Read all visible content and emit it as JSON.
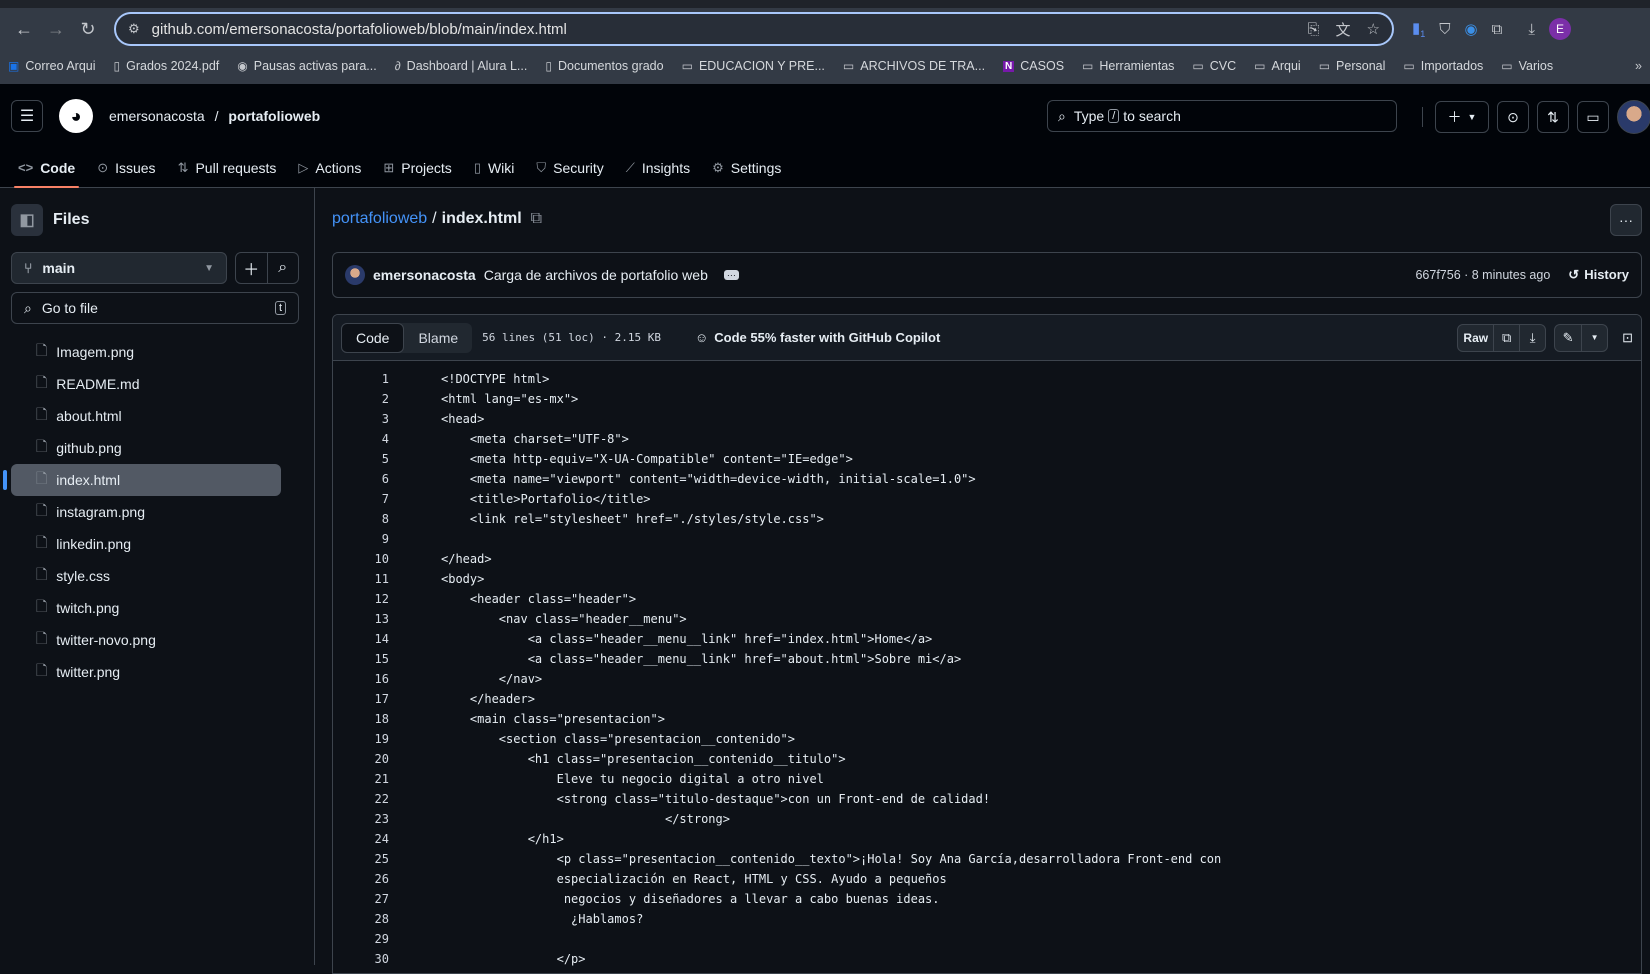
{
  "browser": {
    "url": "github.com/emersonacosta/portafolioweb/blob/main/index.html",
    "extension_badge": "1",
    "profile_initial": "E",
    "bookmarks": [
      {
        "label": "Correo Arqui",
        "icon": "outlook-icon"
      },
      {
        "label": "Grados 2024.pdf",
        "icon": "drive-file-icon"
      },
      {
        "label": "Pausas activas para...",
        "icon": "site-icon"
      },
      {
        "label": "Dashboard | Alura L...",
        "icon": "alura-icon"
      },
      {
        "label": "Documentos grado",
        "icon": "drive-file-icon"
      },
      {
        "label": "EDUCACION Y PRE...",
        "icon": "folder-icon"
      },
      {
        "label": "ARCHIVOS DE TRA...",
        "icon": "folder-icon"
      },
      {
        "label": "CASOS",
        "icon": "onenote-icon"
      },
      {
        "label": "Herramientas",
        "icon": "folder-icon"
      },
      {
        "label": "CVC",
        "icon": "folder-icon"
      },
      {
        "label": "Arqui",
        "icon": "folder-icon"
      },
      {
        "label": "Personal",
        "icon": "folder-icon"
      },
      {
        "label": "Importados",
        "icon": "folder-icon"
      },
      {
        "label": "Varios",
        "icon": "folder-icon"
      }
    ]
  },
  "header": {
    "owner": "emersonacosta",
    "separator": "/",
    "repo": "portafolioweb",
    "search_prefix": "Type",
    "search_key": "/",
    "search_suffix": "to search"
  },
  "repo_nav": [
    {
      "label": "Code",
      "icon": "code-icon",
      "active": true
    },
    {
      "label": "Issues",
      "icon": "issue-icon"
    },
    {
      "label": "Pull requests",
      "icon": "pull-request-icon"
    },
    {
      "label": "Actions",
      "icon": "play-icon"
    },
    {
      "label": "Projects",
      "icon": "table-icon"
    },
    {
      "label": "Wiki",
      "icon": "book-icon"
    },
    {
      "label": "Security",
      "icon": "shield-icon"
    },
    {
      "label": "Insights",
      "icon": "graph-icon"
    },
    {
      "label": "Settings",
      "icon": "gear-icon"
    }
  ],
  "sidebar": {
    "title": "Files",
    "branch": "main",
    "go_to_file": "Go to file",
    "go_to_file_key": "t",
    "files": [
      "Imagem.png",
      "README.md",
      "about.html",
      "github.png",
      "index.html",
      "instagram.png",
      "linkedin.png",
      "style.css",
      "twitch.png",
      "twitter-novo.png",
      "twitter.png"
    ],
    "selected": "index.html"
  },
  "breadcrumb": {
    "repo": "portafolioweb",
    "sep": "/",
    "file": "index.html"
  },
  "commit": {
    "author": "emersonacosta",
    "message": "Carga de archivos de portafolio web",
    "meta": "667f756 · 8 minutes ago",
    "history": "History"
  },
  "toolbar": {
    "code": "Code",
    "blame": "Blame",
    "info": "56 lines (51 loc) · 2.15 KB",
    "copilot": "Code 55% faster with GitHub Copilot",
    "raw": "Raw"
  },
  "colors": {
    "accent": "#4493f8",
    "tab_underline": "#f78166",
    "tag": "#7ee787",
    "attr": "#79c0ff",
    "string": "#a5d6ff"
  },
  "code_lines": [
    "<!DOCTYPE html>",
    "<html lang=\"es-mx\">",
    "<head>",
    "    <meta charset=\"UTF-8\">",
    "    <meta http-equiv=\"X-UA-Compatible\" content=\"IE=edge\">",
    "    <meta name=\"viewport\" content=\"width=device-width, initial-scale=1.0\">",
    "    <title>Portafolio</title>",
    "    <link rel=\"stylesheet\" href=\"./styles/style.css\">",
    "",
    "</head>",
    "<body>",
    "    <header class=\"header\">",
    "        <nav class=\"header__menu\">",
    "            <a class=\"header__menu__link\" href=\"index.html\">Home</a>",
    "            <a class=\"header__menu__link\" href=\"about.html\">Sobre mi</a>",
    "        </nav>",
    "    </header>",
    "    <main class=\"presentacion\">",
    "        <section class=\"presentacion__contenido\">",
    "            <h1 class=\"presentacion__contenido__titulo\">",
    "                Eleve tu negocio digital a otro nivel",
    "                <strong class=\"titulo-destaque\">con un Front-end de calidad!",
    "                               </strong>",
    "            </h1>",
    "                <p class=\"presentacion__contenido__texto\">¡Hola! Soy Ana García,desarrolladora Front-end con",
    "                especialización en React, HTML y CSS. Ayudo a pequeños",
    "                 negocios y diseñadores a llevar a cabo buenas ideas.",
    "                  ¿Hablamos?",
    "",
    "                </p>"
  ]
}
